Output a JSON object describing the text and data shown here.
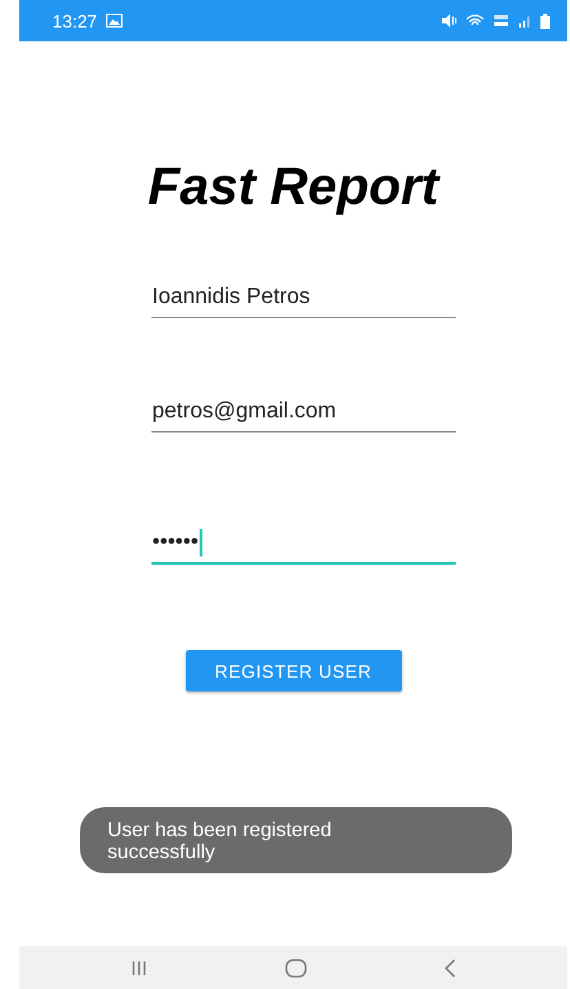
{
  "status_bar": {
    "time": "13:27"
  },
  "app": {
    "title": "Fast Report"
  },
  "fields": [
    {
      "value": "Ioannidis Petros",
      "focused": false
    },
    {
      "value": "petros@gmail.com",
      "focused": false
    },
    {
      "value": "••••••",
      "focused": true
    }
  ],
  "register_button": {
    "label": "REGISTER USER"
  },
  "toast": {
    "message": "User has been registered successfully"
  }
}
